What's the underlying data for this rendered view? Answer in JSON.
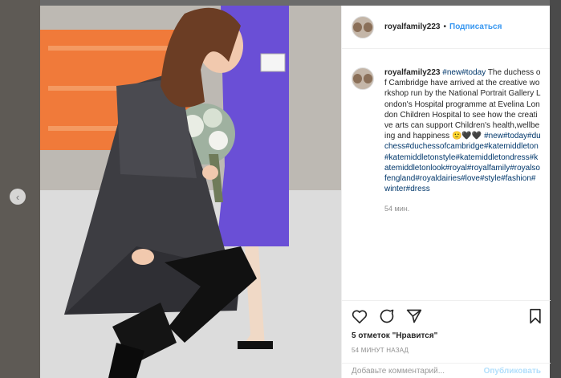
{
  "post": {
    "username": "royalfamily223",
    "follow_label": "Подписаться",
    "caption_username": "royalfamily223",
    "caption_parts": [
      {
        "t": " ",
        "tag": false
      },
      {
        "t": "#new#today",
        "tag": true
      },
      {
        "t": " The duchess of Cambridge have arrived at the creative workshop run by the National Portrait Gallery London's Hospital programme at Evelina London Children Hospital to see how the creative arts can support Children's health,wellbeing and happiness 🙂🖤🖤 ",
        "tag": false
      },
      {
        "t": "#new#today#duchess#duchessofcambridge#katemiddleton#katemiddletonstyle#katemiddletondress#katemiddletonlook#royal#royalfamily#royalsofengland#royaldairies#love#style#fashion#winter#dress",
        "tag": true
      }
    ],
    "caption_time": "54 мин.",
    "likes_count": "5 отметок",
    "likes_suffix": " \"Нравится\"",
    "date": "54 МИНУТ НАЗАД",
    "comment_placeholder": "Добавьте комментарий...",
    "post_label": "Опубликовать"
  },
  "icons": {
    "like": "heart-icon",
    "comment": "comment-icon",
    "share": "share-icon",
    "save": "bookmark-icon",
    "prev": "chevron-left-icon",
    "next": "chevron-right-icon"
  },
  "colors": {
    "link": "#3897f0",
    "hashtag": "#00376b",
    "muted": "#8e8e8e"
  }
}
